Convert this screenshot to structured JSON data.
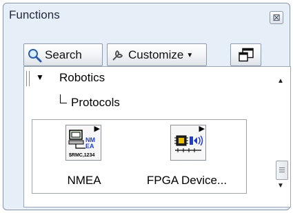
{
  "window": {
    "title": "Functions",
    "close_glyph": "⊠"
  },
  "toolbar": {
    "search_label": "Search",
    "customize_label": "Customize",
    "customize_caret": "▼"
  },
  "tree": {
    "category": "Robotics",
    "category_arrow": "▼",
    "subcategory": "Protocols"
  },
  "items": [
    {
      "label": "NMEA",
      "icon": "nmea-icon"
    },
    {
      "label": "FPGA Device...",
      "icon": "fpga-device-icon"
    }
  ],
  "scrollbar": {
    "up_glyph": "▲",
    "down_glyph": "▼"
  }
}
